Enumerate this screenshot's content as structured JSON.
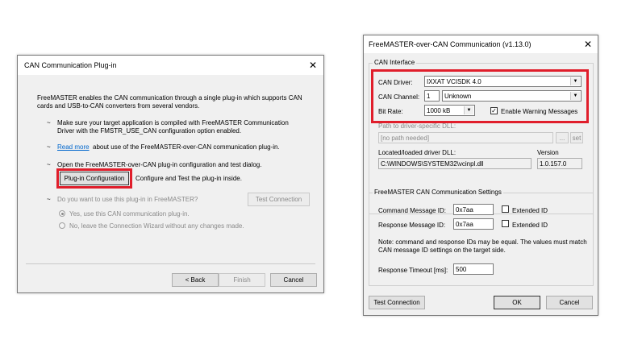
{
  "left_dialog": {
    "title": "CAN Communication Plug-in",
    "intro": "FreeMASTER enables the CAN communication through a single plug-in which supports CAN cards and USB-to-CAN converters from several vendors.",
    "bullet1": "Make sure your target application is compiled with FreeMASTER Communication Driver with the FMSTR_USE_CAN configuration option enabled.",
    "read_more_link": "Read more",
    "bullet2_rest": "about use of the FreeMASTER-over-CAN communication plug-in.",
    "bullet3": "Open the FreeMASTER-over-CAN plug-in configuration and test dialog.",
    "plugin_config_button": "Plug-in Configuration",
    "plugin_config_desc": "Configure and Test the plug-in inside.",
    "question": "Do you want to use this plug-in in FreeMASTER?",
    "test_connection_button": "Test Connection",
    "radio_yes": "Yes, use this CAN communication plug-in.",
    "radio_no": "No, leave the Connection Wizard without any changes made.",
    "back_button": "< Back",
    "finish_button": "Finish",
    "cancel_button": "Cancel"
  },
  "right_dialog": {
    "title": "FreeMASTER-over-CAN Communication (v1.13.0)",
    "can_interface_group": "CAN Interface",
    "can_driver_label": "CAN Driver:",
    "can_driver_value": "IXXAT VCISDK 4.0",
    "can_channel_label": "CAN Channel:",
    "can_channel_value": "1",
    "can_channel_select": "Unknown",
    "bit_rate_label": "Bit Rate:",
    "bit_rate_value": "1000 kB",
    "enable_warnings_label": "Enable Warning Messages",
    "path_label": "Path to driver-specific DLL:",
    "path_placeholder": "[no path needed]",
    "browse_button": "...",
    "set_button": "set",
    "located_label": "Located/loaded driver DLL:",
    "located_value": "C:\\WINDOWS\\SYSTEM32\\vcinpl.dll",
    "version_label": "Version",
    "version_value": "1.0.157.0",
    "settings_group": "FreeMASTER CAN Communication Settings",
    "cmd_id_label": "Command Message ID:",
    "cmd_id_value": "0x7aa",
    "cmd_ext_label": "Extended ID",
    "resp_id_label": "Response Message ID:",
    "resp_id_value": "0x7aa",
    "resp_ext_label": "Extended ID",
    "note": "Note: command and response IDs may be equal. The values must match CAN message ID settings on the target side.",
    "timeout_label": "Response Timeout [ms]:",
    "timeout_value": "500",
    "test_connection_button": "Test Connection",
    "ok_button": "OK",
    "cancel_button": "Cancel"
  },
  "colors": {
    "highlight": "#e01e2b",
    "link": "#0066cc"
  }
}
